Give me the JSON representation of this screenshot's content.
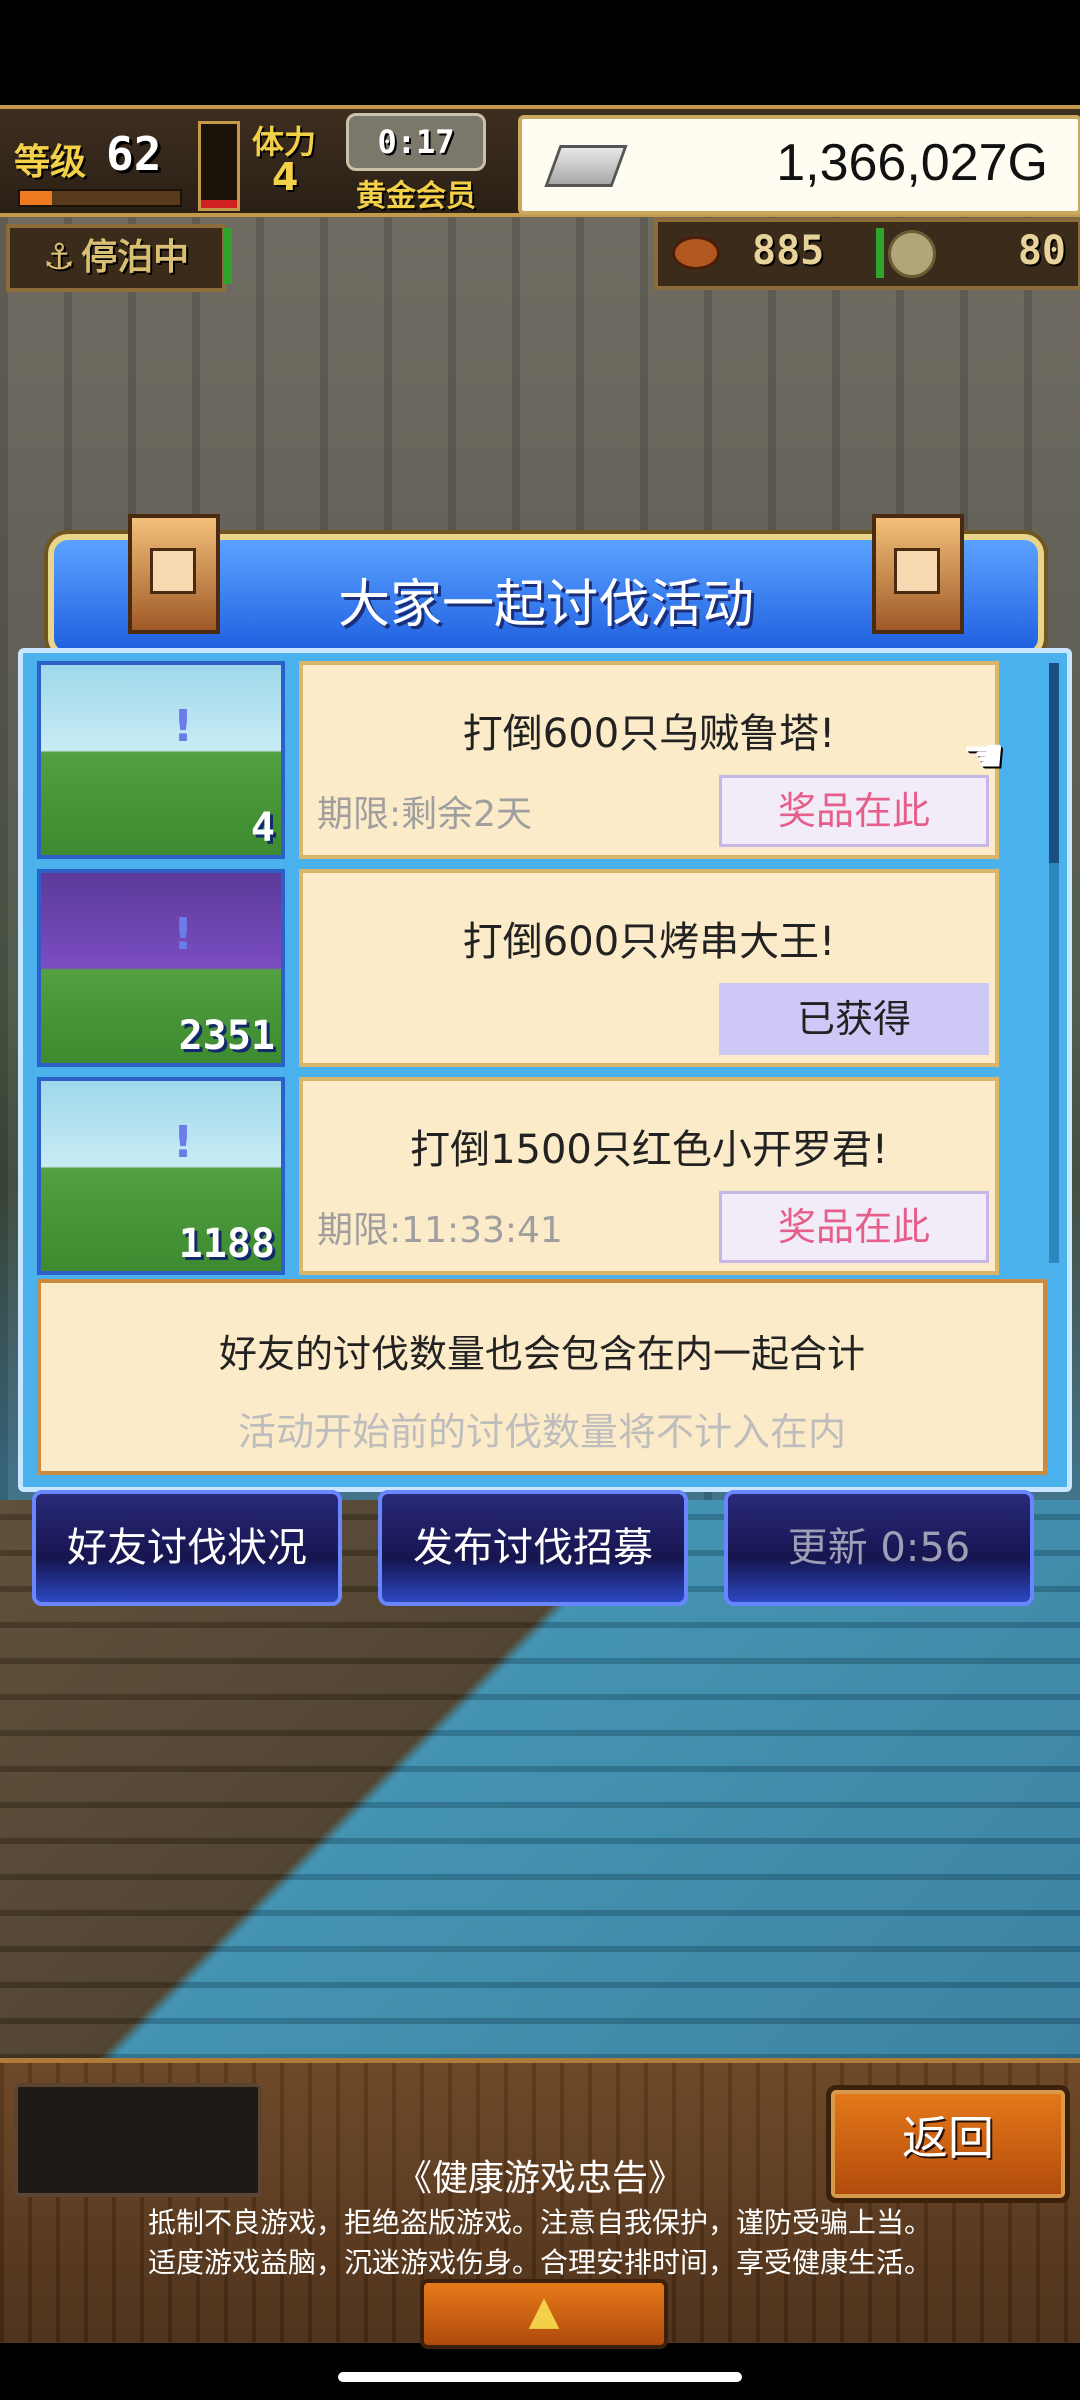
{
  "hud": {
    "level_label": "等级",
    "level": "62",
    "exp_fraction": 0.2,
    "red_gauge_fraction": 0.1,
    "stamina_label": "体力",
    "stamina": "4",
    "timer": "0:17",
    "membership": "黄金会员",
    "money": "1,366,027G",
    "status": "停泊中",
    "meat": "885",
    "coins": "80"
  },
  "panel": {
    "title": "大家一起讨伐活动",
    "quests": [
      {
        "title": "打倒600只乌贼鲁塔!",
        "deadline": "期限:剩余2天",
        "reward_label": "奖品在此",
        "count": "4",
        "claimed": false
      },
      {
        "title": "打倒600只烤串大王!",
        "deadline": "",
        "reward_label": "已获得",
        "count": "2351",
        "claimed": true
      },
      {
        "title": "打倒1500只红色小开罗君!",
        "deadline": "期限:11:33:41",
        "reward_label": "奖品在此",
        "count": "1188",
        "claimed": false
      }
    ],
    "note_main": "好友的讨伐数量也会包含在内一起合计",
    "note_sub": "活动开始前的讨伐数量将不计入在内"
  },
  "actions": {
    "friend_status": "好友讨伐状况",
    "post_recruit": "发布讨伐招募",
    "refresh": "更新 0:56"
  },
  "footer": {
    "back_label": "返回",
    "advisory_title": "《健康游戏忠告》",
    "advisory_line1": "抵制不良游戏，拒绝盗版游戏。注意自我保护，谨防受骗上当。",
    "advisory_line2": "适度游戏益脑，沉迷游戏伤身。合理安排时间，享受健康生活。",
    "expand_icon": "up-triangle-icon"
  }
}
